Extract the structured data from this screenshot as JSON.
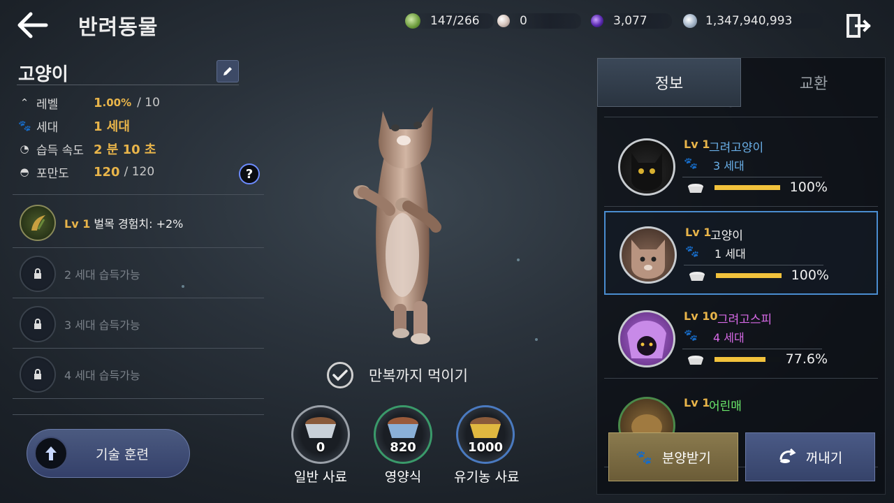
{
  "header": {
    "title": "반려동물",
    "currencies": [
      {
        "icon": "green-gem-icon",
        "value": "147/266",
        "color": "#7fb05a"
      },
      {
        "icon": "pearl-icon",
        "value": "0",
        "color": "#d9c9c0"
      },
      {
        "icon": "purple-orb-icon",
        "value": "3,077",
        "color": "#6a3cc9"
      },
      {
        "icon": "silver-coin-icon",
        "value": "1,347,940,993",
        "color": "#a9b9cc"
      }
    ]
  },
  "pet": {
    "name": "고양이",
    "stats": {
      "level_label": "레벨",
      "level_value": "1",
      "level_pct": ".00%",
      "level_max": "/ 10",
      "generation_label": "세대",
      "generation_value": "1 세대",
      "speed_label": "습득 속도",
      "speed_value": "2 분 10 초",
      "fullness_label": "포만도",
      "fullness_value": "120",
      "fullness_max": "/ 120"
    }
  },
  "skills": [
    {
      "level": "Lv 1",
      "text": "벌목 경험치: +2%"
    },
    {
      "text": "2 세대 습득가능"
    },
    {
      "text": "3 세대 습득가능"
    },
    {
      "text": "4 세대 습득가능"
    }
  ],
  "skill_button": "기술 훈련",
  "feed_to_full": "만복까지 먹이기",
  "foods": [
    {
      "count": "0",
      "name": "일반 사료",
      "ring": "#9aa0a8",
      "food_color": "#8a5a3a"
    },
    {
      "count": "820",
      "name": "영양식",
      "ring": "#3a9a6a",
      "food_color": "#9a5a3a"
    },
    {
      "count": "1000",
      "name": "유기농 사료",
      "ring": "#4a7ac0",
      "food_color": "#c9a040"
    }
  ],
  "tabs": {
    "info": "정보",
    "exchange": "교환"
  },
  "pet_list": [
    {
      "level": "Lv 1",
      "name": "그려고양이",
      "name_color": "#6ab0e8",
      "generation": "3 세대",
      "gen_color": "#6ab0e8",
      "fullness": 100,
      "fullness_text": "100%",
      "avatar": "black-cat"
    },
    {
      "level": "Lv 1",
      "name": "고양이",
      "name_color": "#f0f0f0",
      "generation": "1 세대",
      "gen_color": "#f0f0f0",
      "fullness": 100,
      "fullness_text": "100%",
      "avatar": "tabby-cat"
    },
    {
      "level": "Lv 10",
      "name": "그려고스피",
      "name_color": "#d86ae8",
      "generation": "4 세대",
      "gen_color": "#d86ae8",
      "fullness": 77.6,
      "fullness_text": "77.6%",
      "avatar": "purple-ghost"
    },
    {
      "level": "Lv 1",
      "name": "어린매",
      "name_color": "#6ae86a",
      "generation": "",
      "gen_color": "#6ae86a",
      "fullness": 0,
      "fullness_text": "",
      "avatar": "hawk"
    }
  ],
  "buttons": {
    "adopt": "분양받기",
    "take_out": "꺼내기"
  }
}
